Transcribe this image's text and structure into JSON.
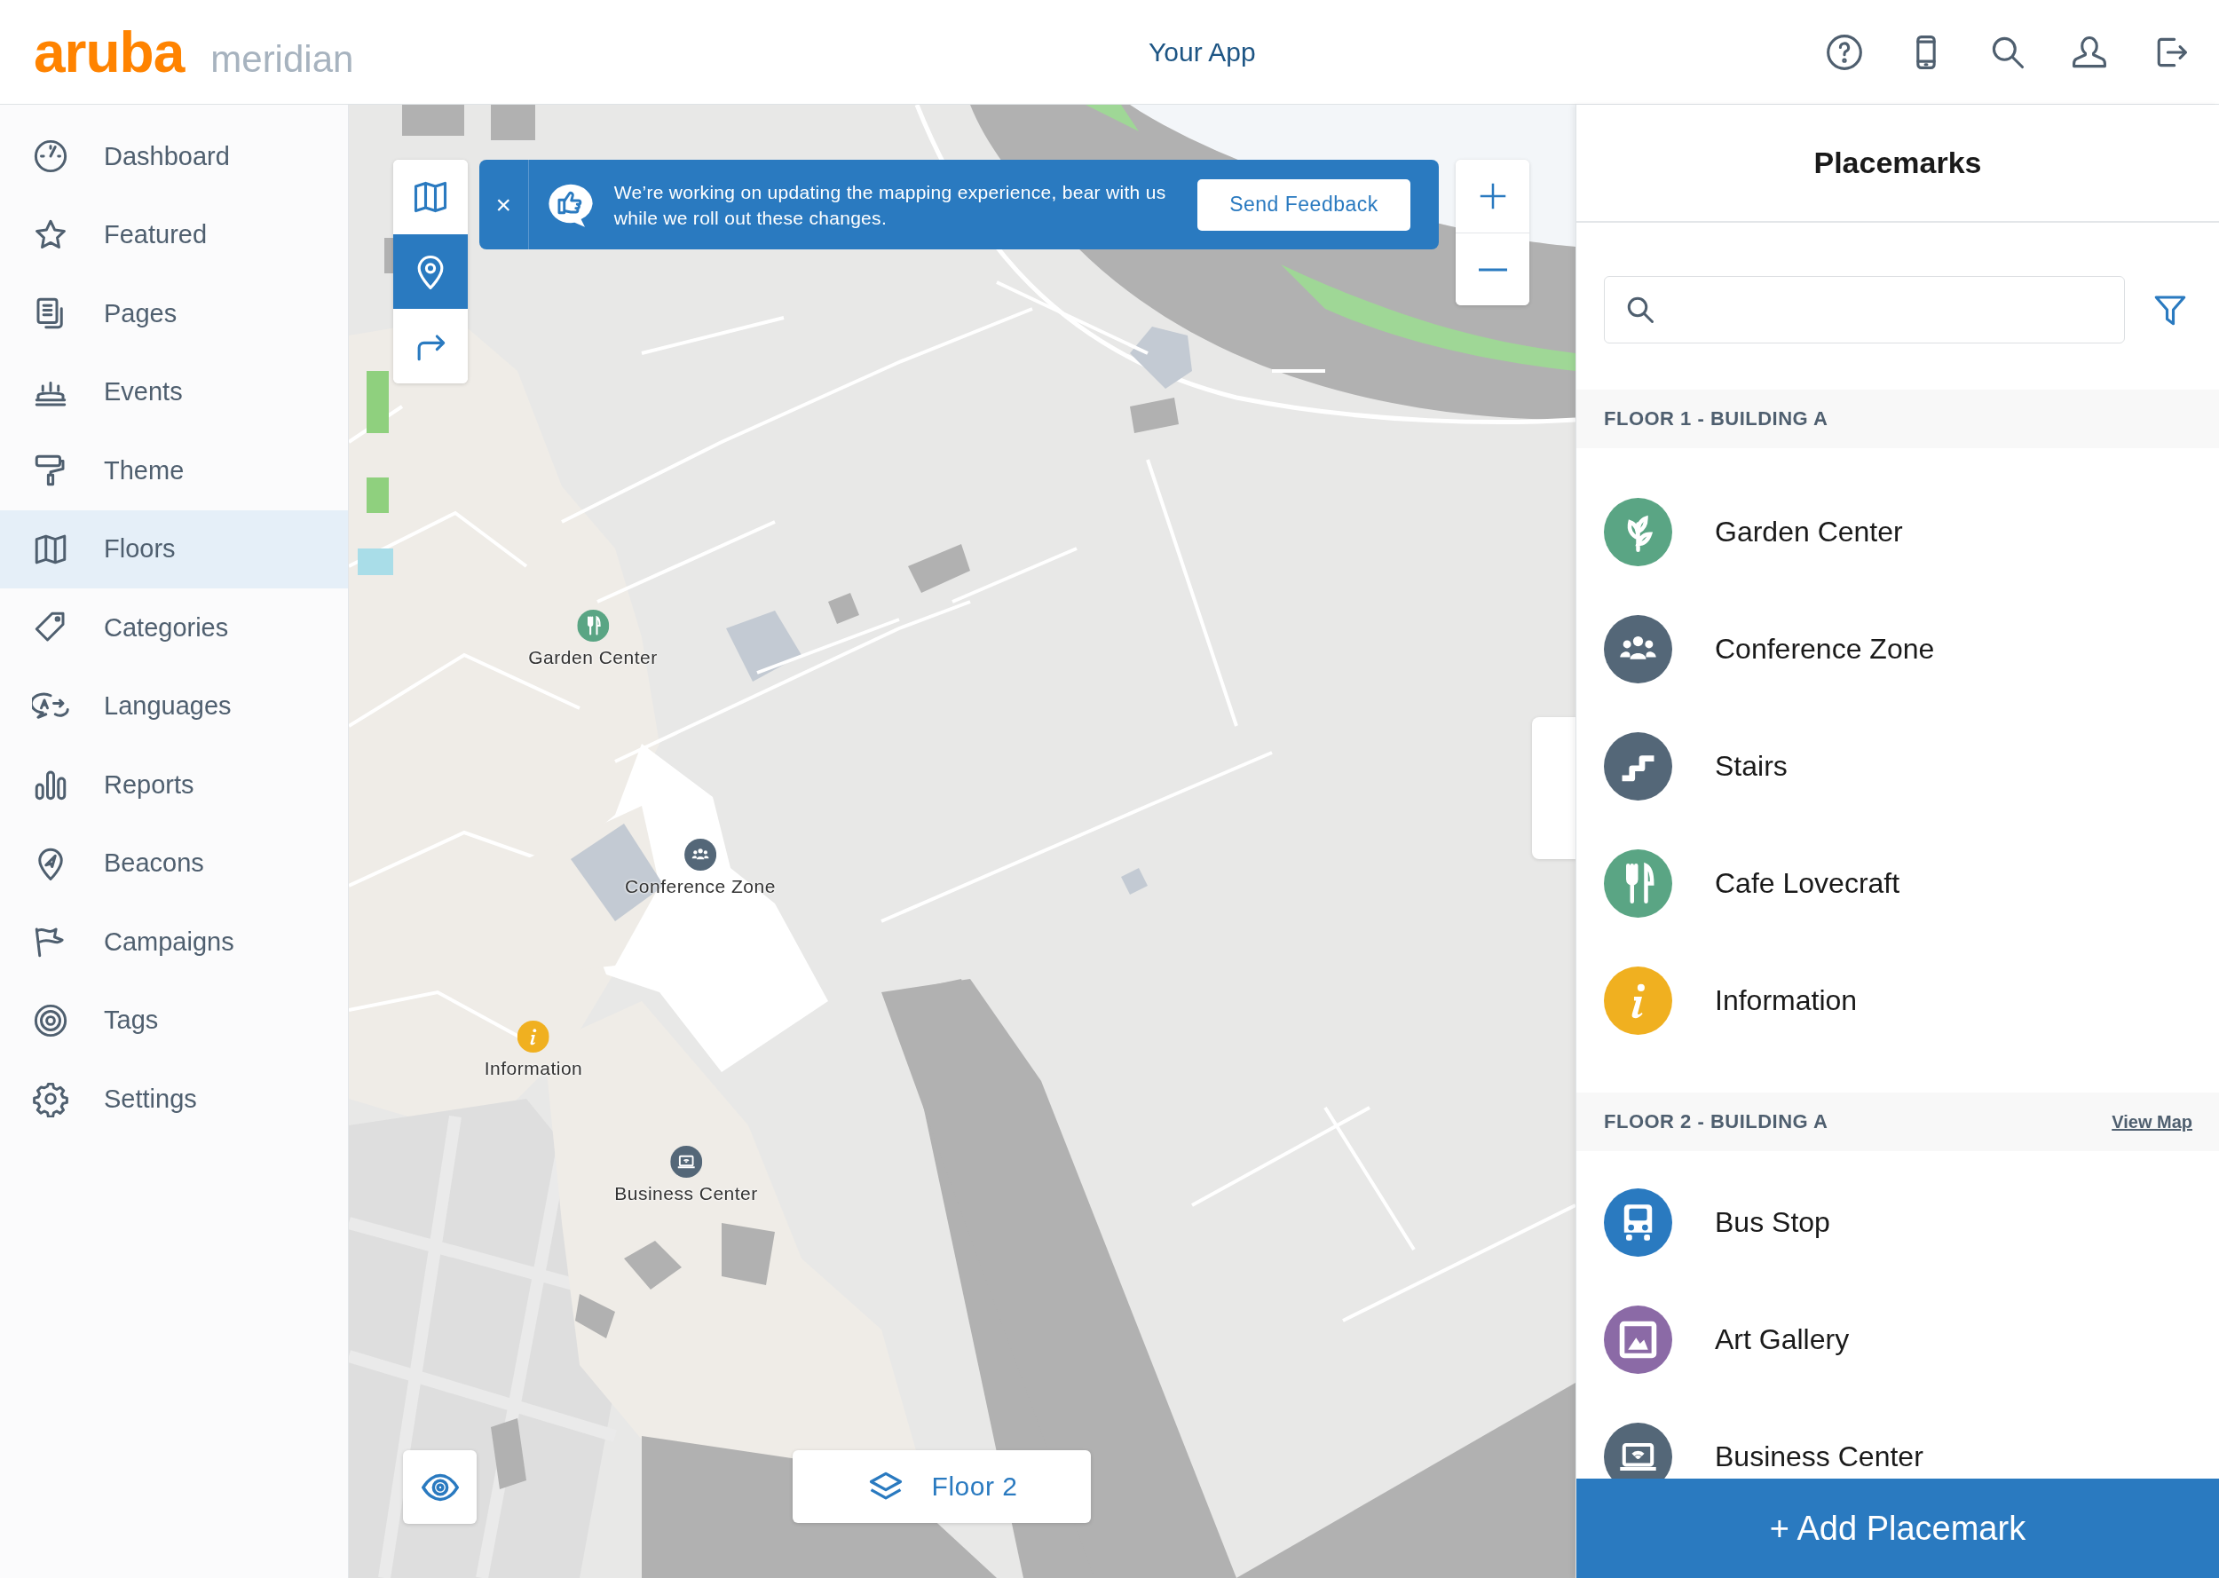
{
  "header": {
    "logo": "aruba",
    "product": "meridian",
    "app_name": "Your App"
  },
  "sidebar": {
    "items": [
      {
        "label": "Dashboard",
        "kind": "gauge",
        "selected": false
      },
      {
        "label": "Featured",
        "kind": "star",
        "selected": false
      },
      {
        "label": "Pages",
        "kind": "pages",
        "selected": false
      },
      {
        "label": "Events",
        "kind": "events",
        "selected": false
      },
      {
        "label": "Theme",
        "kind": "roller",
        "selected": false
      },
      {
        "label": "Floors",
        "kind": "map",
        "selected": true
      },
      {
        "label": "Categories",
        "kind": "tag",
        "selected": false
      },
      {
        "label": "Languages",
        "kind": "languages",
        "selected": false
      },
      {
        "label": "Reports",
        "kind": "reports",
        "selected": false
      },
      {
        "label": "Beacons",
        "kind": "beacon",
        "selected": false
      },
      {
        "label": "Campaigns",
        "kind": "flag",
        "selected": false
      },
      {
        "label": "Tags",
        "kind": "target",
        "selected": false
      },
      {
        "label": "Settings",
        "kind": "gear",
        "selected": false
      }
    ]
  },
  "map": {
    "tools": [
      {
        "kind": "map",
        "selected": false
      },
      {
        "kind": "pin",
        "selected": true
      },
      {
        "kind": "route",
        "selected": false
      }
    ],
    "banner": {
      "close": "×",
      "message": "We’re working on updating the mapping experience, bear with us while we roll out these changes.",
      "button": "Send Feedback"
    },
    "placemarks": [
      {
        "label": "Garden Center",
        "kind": "fork",
        "color": "#5aa584"
      },
      {
        "label": "Conference Zone",
        "kind": "group",
        "color": "#546778"
      },
      {
        "label": "Information",
        "kind": "info",
        "color": "#f0b020"
      },
      {
        "label": "Business Center",
        "kind": "laptop",
        "color": "#546778"
      }
    ],
    "floor_button": "Floor 2"
  },
  "panel": {
    "title": "Placemarks",
    "sections": [
      {
        "title": "FLOOR 1 - BUILDING A",
        "items": [
          {
            "label": "Garden Center",
            "kind": "leaf",
            "color": "#5aa584"
          },
          {
            "label": "Conference Zone",
            "kind": "group",
            "color": "#546778"
          },
          {
            "label": "Stairs",
            "kind": "stairs",
            "color": "#546778"
          },
          {
            "label": "Cafe Lovecraft",
            "kind": "fork",
            "color": "#5aa584"
          },
          {
            "label": "Information",
            "kind": "info",
            "color": "#f0b020"
          }
        ]
      },
      {
        "title": "FLOOR 2 - BUILDING A",
        "link": "View Map",
        "items": [
          {
            "label": "Bus Stop",
            "kind": "bus",
            "color": "#2a7ac0"
          },
          {
            "label": "Art Gallery",
            "kind": "art",
            "color": "#8b6aa6"
          },
          {
            "label": "Business Center",
            "kind": "laptop",
            "color": "#546778"
          }
        ]
      }
    ],
    "add_button": "+ Add Placemark"
  }
}
